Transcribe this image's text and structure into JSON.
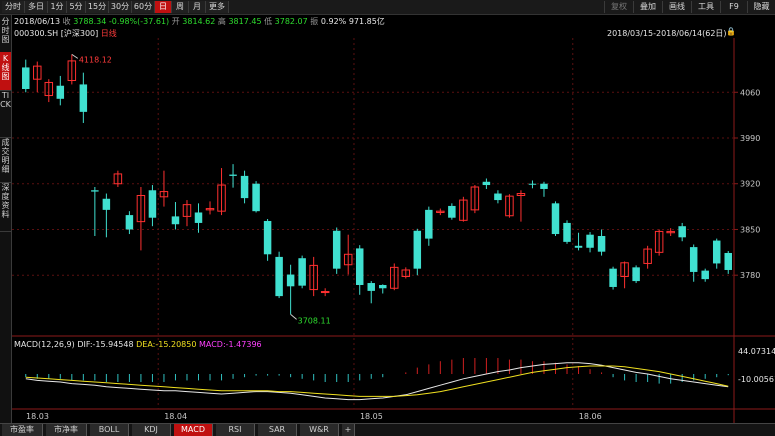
{
  "toolbar": {
    "periods": [
      "分时",
      "多日",
      "1分",
      "5分",
      "15分",
      "30分",
      "60分",
      "日",
      "周",
      "月",
      "更多"
    ],
    "active_period": "日",
    "right_buttons": [
      "复权",
      "叠加",
      "画线",
      "工具",
      "F9",
      "隐藏"
    ]
  },
  "left_tabs": [
    {
      "label": "分时图",
      "active": false
    },
    {
      "label": "K线图",
      "active": true
    },
    {
      "label": "TICK",
      "active": false
    },
    {
      "label": "成交明细",
      "active": false
    },
    {
      "label": "深度资料",
      "active": false
    }
  ],
  "quote": {
    "date": "2018/06/13",
    "close_label": "收",
    "close": "3788.34",
    "change": "-0.98%(-37.61)",
    "open_label": "开",
    "open": "3814.62",
    "high_label": "高",
    "high": "3817.45",
    "low_label": "低",
    "low": "3782.07",
    "amp_label": "振",
    "amp": "0.92%",
    "volume": "971.85亿"
  },
  "symbol": {
    "code": "000300.SH",
    "name": "[沪深300]",
    "period": "日线",
    "range": "2018/03/15-2018/06/14(62日)"
  },
  "annotations": {
    "max_label": "4118.12",
    "min_label": "3708.11"
  },
  "macd": {
    "title": "MACD(12,26,9)",
    "dif": "DIF:-15.94548",
    "dea": "DEA:-15.20850",
    "macd": "MACD:-1.47396",
    "axis_top": "44.07314",
    "axis_mid": "-10.00561"
  },
  "chart_data": {
    "type": "candlestick",
    "ylim": [
      3690,
      4140
    ],
    "y_ticks": [
      4060,
      3990,
      3920,
      3850,
      3780
    ],
    "x_ticks": [
      {
        "label": "18.03",
        "index": 0
      },
      {
        "label": "18.04",
        "index": 12
      },
      {
        "label": "18.05",
        "index": 29
      },
      {
        "label": "18.06",
        "index": 48
      }
    ],
    "candles": [
      [
        4065,
        4098,
        4060,
        4110,
        "down"
      ],
      [
        4080,
        4100,
        4060,
        4107,
        "up"
      ],
      [
        4055,
        4075,
        4045,
        4080,
        "up"
      ],
      [
        4070,
        4050,
        4040,
        4085,
        "down"
      ],
      [
        4078,
        4108,
        4072,
        4118,
        "up"
      ],
      [
        4072,
        4030,
        4013,
        4090,
        "down"
      ],
      [
        3910,
        3908,
        3840,
        3915,
        "down"
      ],
      [
        3897,
        3880,
        3838,
        3905,
        "down"
      ],
      [
        3920,
        3935,
        3915,
        3940,
        "up"
      ],
      [
        3872,
        3850,
        3843,
        3878,
        "down"
      ],
      [
        3862,
        3902,
        3818,
        3915,
        "up"
      ],
      [
        3910,
        3868,
        3855,
        3918,
        "down"
      ],
      [
        3900,
        3908,
        3885,
        3940,
        "up"
      ],
      [
        3870,
        3858,
        3850,
        3892,
        "down"
      ],
      [
        3870,
        3888,
        3855,
        3895,
        "up"
      ],
      [
        3876,
        3860,
        3845,
        3890,
        "down"
      ],
      [
        3880,
        3882,
        3873,
        3893,
        "up"
      ],
      [
        3878,
        3918,
        3872,
        3944,
        "up"
      ],
      [
        3934,
        3932,
        3914,
        3950,
        "down"
      ],
      [
        3932,
        3898,
        3890,
        3940,
        "down"
      ],
      [
        3920,
        3878,
        3876,
        3924,
        "down"
      ],
      [
        3863,
        3812,
        3802,
        3866,
        "down"
      ],
      [
        3808,
        3748,
        3745,
        3816,
        "down"
      ],
      [
        3781,
        3763,
        3720,
        3796,
        "down"
      ],
      [
        3806,
        3764,
        3760,
        3810,
        "down"
      ],
      [
        3758,
        3795,
        3748,
        3808,
        "up"
      ],
      [
        3755,
        3755,
        3748,
        3760,
        "up"
      ],
      [
        3848,
        3790,
        3782,
        3853,
        "down"
      ],
      [
        3796,
        3812,
        3781,
        3842,
        "up"
      ],
      [
        3821,
        3765,
        3750,
        3826,
        "down"
      ],
      [
        3768,
        3756,
        3737,
        3771,
        "down"
      ],
      [
        3765,
        3760,
        3752,
        3766,
        "down"
      ],
      [
        3792,
        3760,
        3757,
        3798,
        "up"
      ],
      [
        3778,
        3788,
        3775,
        3792,
        "up"
      ],
      [
        3848,
        3790,
        3780,
        3851,
        "down"
      ],
      [
        3880,
        3836,
        3825,
        3885,
        "down"
      ],
      [
        3876,
        3878,
        3872,
        3882,
        "up"
      ],
      [
        3886,
        3868,
        3865,
        3890,
        "down"
      ],
      [
        3864,
        3895,
        3862,
        3900,
        "up"
      ],
      [
        3880,
        3915,
        3875,
        3918,
        "up"
      ],
      [
        3923,
        3918,
        3912,
        3928,
        "down"
      ],
      [
        3905,
        3895,
        3890,
        3910,
        "down"
      ],
      [
        3871,
        3901,
        3868,
        3904,
        "up"
      ],
      [
        3905,
        3902,
        3862,
        3910,
        "up"
      ],
      [
        3920,
        3920,
        3913,
        3925,
        "down"
      ],
      [
        3920,
        3912,
        3900,
        3923,
        "down"
      ],
      [
        3890,
        3843,
        3840,
        3893,
        "down"
      ],
      [
        3860,
        3831,
        3828,
        3864,
        "down"
      ],
      [
        3825,
        3822,
        3818,
        3845,
        "down"
      ],
      [
        3822,
        3842,
        3815,
        3846,
        "down"
      ],
      [
        3840,
        3816,
        3810,
        3850,
        "down"
      ],
      [
        3790,
        3762,
        3758,
        3793,
        "down"
      ],
      [
        3778,
        3799,
        3760,
        3801,
        "up"
      ],
      [
        3792,
        3771,
        3768,
        3795,
        "down"
      ],
      [
        3798,
        3820,
        3790,
        3825,
        "up"
      ],
      [
        3847,
        3815,
        3810,
        3850,
        "up"
      ],
      [
        3847,
        3845,
        3840,
        3852,
        "up"
      ],
      [
        3855,
        3838,
        3832,
        3860,
        "down"
      ],
      [
        3823,
        3785,
        3770,
        3827,
        "down"
      ],
      [
        3787,
        3774,
        3770,
        3790,
        "down"
      ],
      [
        3833,
        3798,
        3790,
        3836,
        "down"
      ],
      [
        3814,
        3788,
        3782,
        3817,
        "down"
      ]
    ],
    "macd_series": {
      "dif": [
        -6,
        -8,
        -9,
        -10,
        -12,
        -13,
        -14,
        -16,
        -17,
        -18,
        -19,
        -20,
        -21,
        -21,
        -22,
        -23,
        -24,
        -25,
        -24,
        -23,
        -22,
        -22,
        -23,
        -24,
        -26,
        -28,
        -30,
        -31,
        -32,
        -32,
        -31,
        -30,
        -28,
        -26,
        -22,
        -18,
        -14,
        -10,
        -6,
        -3,
        0,
        3,
        5,
        8,
        10,
        12,
        13,
        14,
        14,
        13,
        11,
        8,
        5,
        2,
        0,
        -3,
        -6,
        -8,
        -10,
        -12,
        -14,
        -15.9
      ],
      "dea": [
        -4,
        -5,
        -6,
        -7,
        -8,
        -9,
        -10,
        -11,
        -12,
        -13,
        -14,
        -15,
        -16,
        -17,
        -18,
        -19,
        -20,
        -21,
        -21,
        -21,
        -21,
        -21,
        -22,
        -22,
        -23,
        -24,
        -25,
        -26,
        -27,
        -28,
        -28,
        -28,
        -28,
        -27,
        -26,
        -24,
        -22,
        -19,
        -16,
        -13,
        -10,
        -7,
        -4,
        -1,
        2,
        4,
        6,
        8,
        9,
        10,
        10,
        10,
        9,
        7,
        5,
        3,
        0,
        -3,
        -6,
        -9,
        -12,
        -15.2
      ],
      "hist": [
        -4,
        -6,
        -6,
        -6,
        -8,
        -8,
        -8,
        -10,
        -10,
        -10,
        -10,
        -10,
        -10,
        -8,
        -8,
        -8,
        -8,
        -8,
        -6,
        -4,
        -2,
        -2,
        -2,
        -4,
        -6,
        -8,
        -10,
        -10,
        -10,
        -8,
        -6,
        -4,
        0,
        2,
        8,
        12,
        16,
        18,
        20,
        20,
        20,
        20,
        18,
        18,
        16,
        16,
        14,
        12,
        10,
        6,
        2,
        -4,
        -8,
        -10,
        -10,
        -12,
        -12,
        -10,
        -8,
        -6,
        -4,
        -1.5
      ]
    }
  },
  "bottom_tabs": [
    "市盈率",
    "市净率",
    "BOLL",
    "KDJ",
    "MACD",
    "RSI",
    "SAR",
    "W&R",
    "+"
  ],
  "active_bottom_tab": "MACD"
}
